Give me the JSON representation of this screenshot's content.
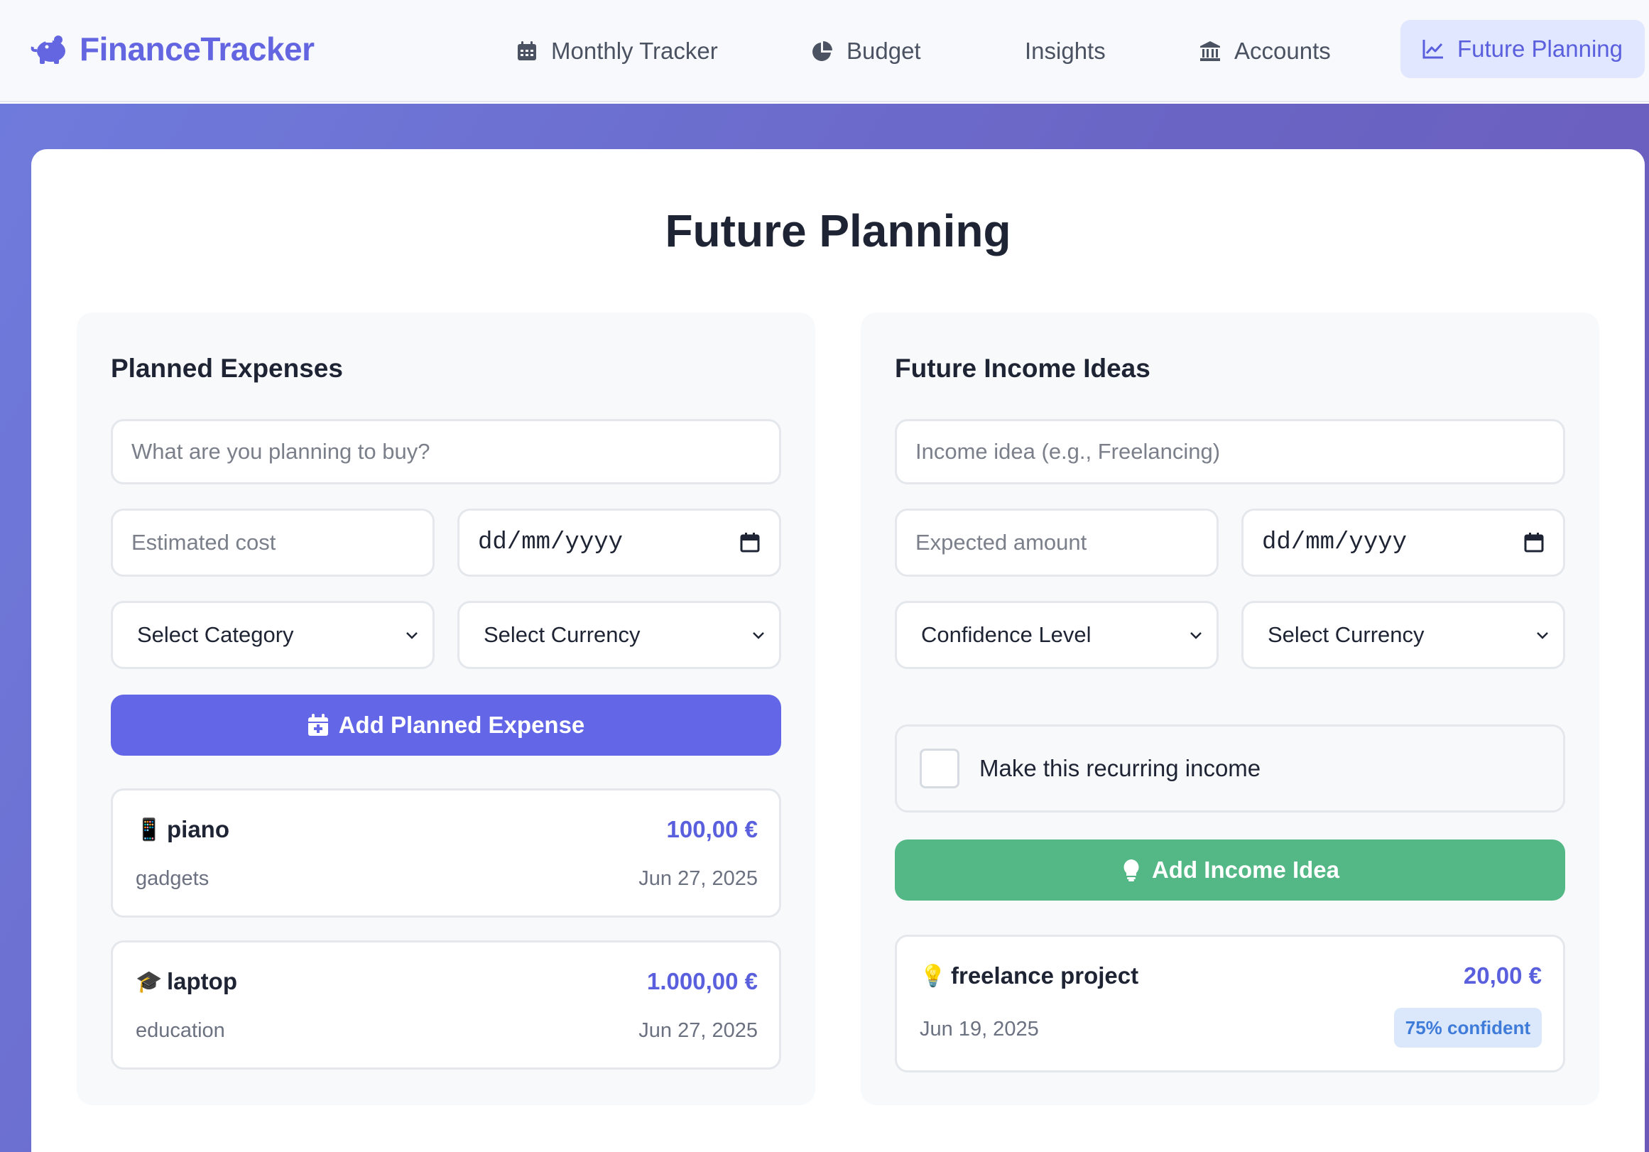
{
  "brand": {
    "name": "FinanceTracker",
    "icon": "piggy-bank-icon"
  },
  "nav": {
    "items": [
      {
        "label": "Monthly Tracker",
        "icon": "calendar-icon"
      },
      {
        "label": "Budget",
        "icon": "pie-chart-icon"
      },
      {
        "label": "Insights",
        "icon": ""
      },
      {
        "label": "Accounts",
        "icon": "bank-icon"
      },
      {
        "label": "Future Planning",
        "icon": "line-chart-icon",
        "active": true
      }
    ]
  },
  "page": {
    "title": "Future Planning"
  },
  "expenses": {
    "title": "Planned Expenses",
    "item_placeholder": "What are you planning to buy?",
    "cost_placeholder": "Estimated cost",
    "date_placeholder": "dd/mm/yyyy",
    "category_select": "Select Category",
    "currency_select": "Select Currency",
    "add_button": "Add Planned Expense",
    "list": [
      {
        "emoji": "📱",
        "name": "piano",
        "amount": "100,00 €",
        "category": "gadgets",
        "date": "Jun 27, 2025"
      },
      {
        "emoji": "🎓",
        "name": "laptop",
        "amount": "1.000,00 €",
        "category": "education",
        "date": "Jun 27, 2025"
      }
    ]
  },
  "income": {
    "title": "Future Income Ideas",
    "idea_placeholder": "Income idea (e.g., Freelancing)",
    "amount_placeholder": "Expected amount",
    "date_placeholder": "dd/mm/yyyy",
    "confidence_select": "Confidence Level",
    "currency_select": "Select Currency",
    "recurring_label": "Make this recurring income",
    "recurring_checked": false,
    "add_button": "Add Income Idea",
    "list": [
      {
        "emoji": "💡",
        "name": "freelance project",
        "amount": "20,00 €",
        "date": "Jun 19, 2025",
        "confidence": "75% confident"
      }
    ]
  },
  "colors": {
    "accent": "#6366e6",
    "success": "#54b886",
    "badge_bg": "#dbe8fb",
    "badge_text": "#3f7bd9",
    "gradient_start": "#6f7bdc",
    "gradient_end": "#6d5ab8"
  }
}
